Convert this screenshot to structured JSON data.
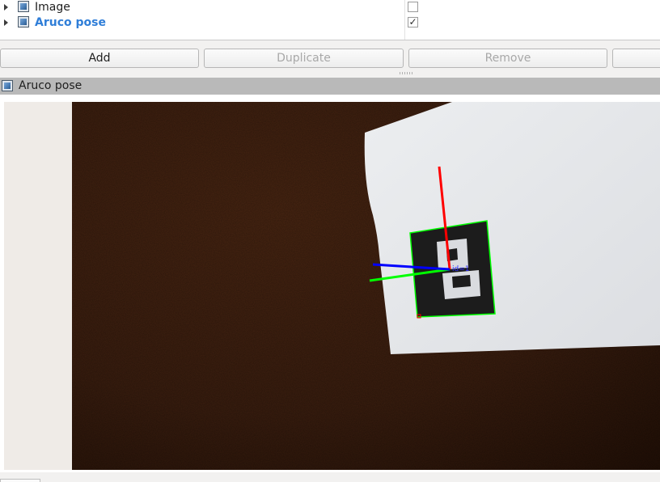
{
  "displays": [
    {
      "label": "Image",
      "checked": false,
      "selected": false
    },
    {
      "label": "Aruco pose",
      "checked": true,
      "selected": true
    }
  ],
  "checkmark_glyph": "✓",
  "buttons": {
    "add": "Add",
    "duplicate": "Duplicate",
    "remove": "Remove",
    "rename": ""
  },
  "panel": {
    "title": "Aruco pose"
  },
  "camera_view": {
    "marker_id_label": "id=1"
  },
  "colors": {
    "selected_text": "#2f7ed8",
    "axis_x": "#ff0000",
    "axis_y": "#00ff00",
    "axis_z": "#0000ff",
    "marker_outline": "#00ff00"
  }
}
